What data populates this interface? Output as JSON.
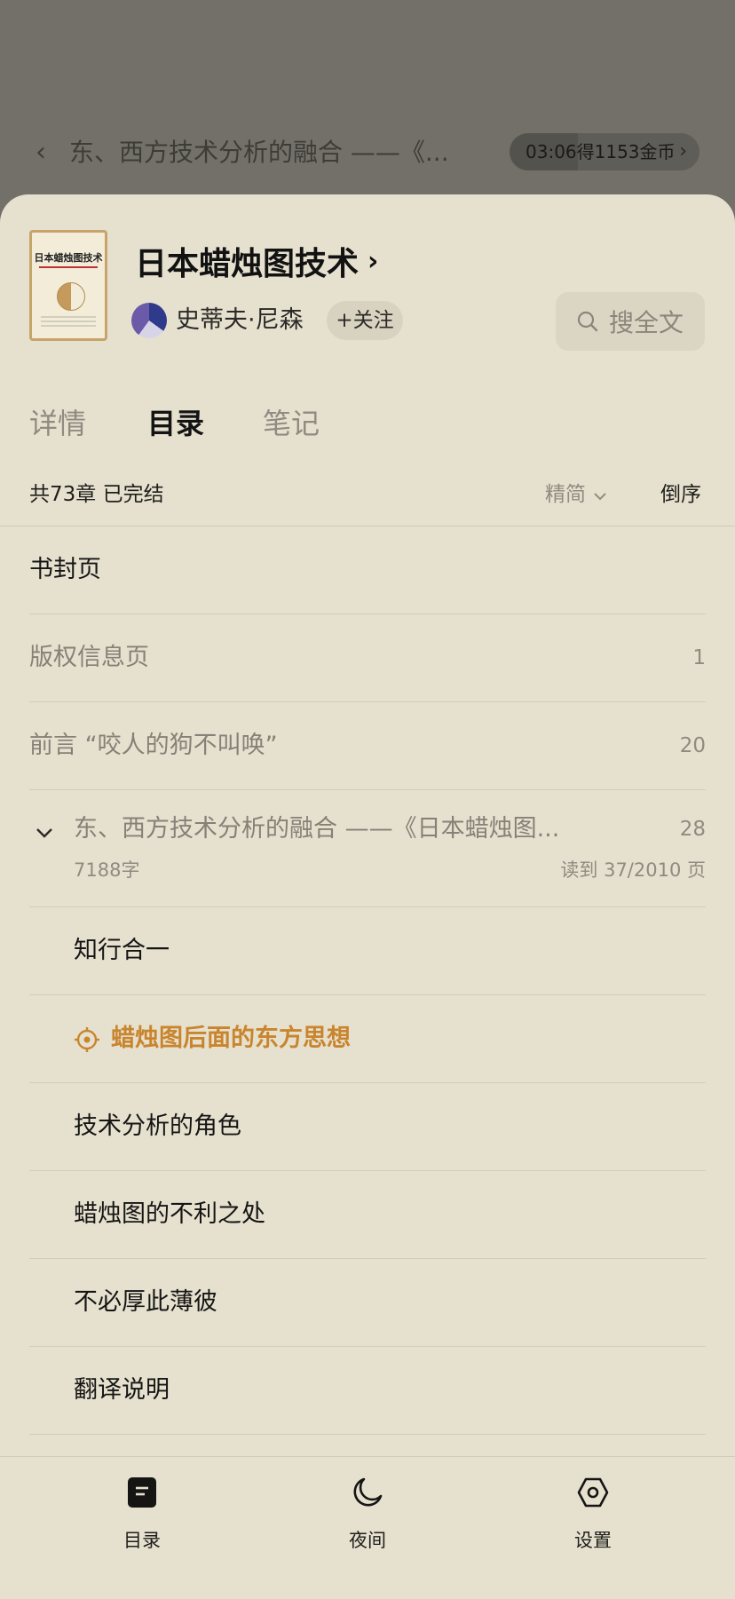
{
  "reader": {
    "back_icon": "chevron-left-icon",
    "chapter_title": "东、西方技术分析的融合 ——《...",
    "timer": {
      "label": "03:06得1153金币",
      "progress": 0.36
    }
  },
  "book": {
    "cover_title": "日本蜡烛图技术",
    "title": "日本蜡烛图技术",
    "author": "史蒂夫·尼森",
    "follow_label": "+关注",
    "search_label": "搜全文"
  },
  "tabs": [
    {
      "label": "详情",
      "active": false
    },
    {
      "label": "目录",
      "active": true
    },
    {
      "label": "笔记",
      "active": false
    }
  ],
  "toc_header": {
    "summary": "共73章 已完结",
    "sort_label": "精简",
    "reverse_label": "倒序"
  },
  "toc": {
    "items_top": [
      {
        "label": "书封页",
        "page": "",
        "style": "dark"
      },
      {
        "label": "版权信息页",
        "page": "1",
        "style": "dim"
      },
      {
        "label": "前言 “咬人的狗不叫唤”",
        "page": "20",
        "style": "dim"
      }
    ],
    "expanded": {
      "label": "东、西方技术分析的融合 ——《日本蜡烛图...",
      "page": "28",
      "words": "7188字",
      "progress": "读到 37/2010 页"
    },
    "sub_items": [
      {
        "label": "知行合一",
        "current": false
      },
      {
        "label": "蜡烛图后面的东方思想",
        "current": true
      },
      {
        "label": "技术分析的角色",
        "current": false
      },
      {
        "label": "蜡烛图的不利之处",
        "current": false
      },
      {
        "label": "不必厚此薄彼",
        "current": false
      },
      {
        "label": "翻译说明",
        "current": false
      }
    ]
  },
  "toolbar": {
    "toc_label": "目录",
    "night_label": "夜间",
    "settings_label": "设置"
  },
  "colors": {
    "sheet_bg": "#e6e1cf",
    "accent": "#c9852e"
  }
}
